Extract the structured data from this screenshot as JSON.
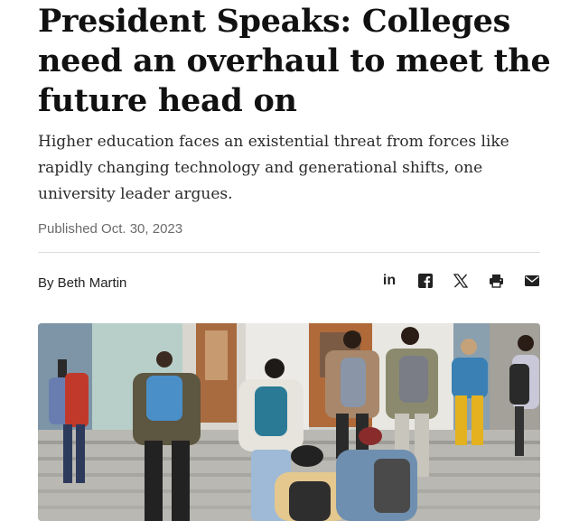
{
  "article": {
    "headline": "President Speaks: Colleges need an overhaul to meet the future head on",
    "dek": "Higher education faces an existential threat from forces like rapidly changing technology and generational shifts, one university leader argues.",
    "published": "Published Oct. 30, 2023",
    "byline": "By Beth Martin"
  },
  "share": {
    "icons": [
      "linkedin-icon",
      "facebook-icon",
      "x-icon",
      "print-icon",
      "email-icon"
    ],
    "linkedin_label": "in"
  },
  "colors": {
    "text": "#111111",
    "muted": "#6b6b6b",
    "divider": "#dcdcdc",
    "icon": "#222222"
  },
  "photo": {
    "subject": "students-walking-up-campus-steps"
  }
}
